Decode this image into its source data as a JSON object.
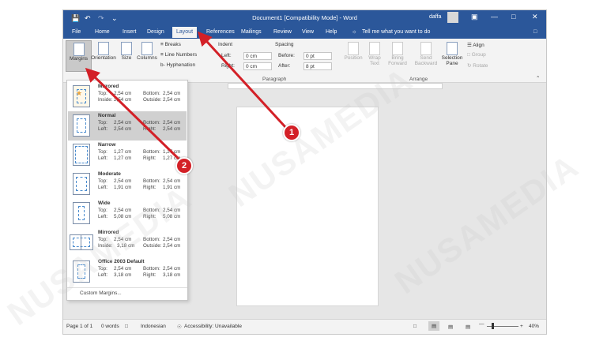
{
  "window": {
    "title": "Document1 [Compatibility Mode] - Word",
    "user": "daffa"
  },
  "tabs": [
    "File",
    "Home",
    "Insert",
    "Design",
    "Layout",
    "References",
    "Mailings",
    "Review",
    "View",
    "Help"
  ],
  "tell_me": "Tell me what you want to do",
  "ribbon": {
    "margins": "Margins",
    "orientation": "Orientation",
    "size": "Size",
    "columns": "Columns",
    "breaks": "Breaks",
    "line_numbers": "Line Numbers",
    "hyphenation": "Hyphenation",
    "indent": "Indent",
    "left_label": "Left:",
    "left_value": "0 cm",
    "right_label": "Right:",
    "right_value": "0 cm",
    "spacing": "Spacing",
    "before_label": "Before:",
    "before_value": "0 pt",
    "after_label": "After:",
    "after_value": "8 pt",
    "paragraph_group": "Paragraph",
    "position": "Position",
    "wrap_text": "Wrap Text",
    "bring_forward": "Bring Forward",
    "send_backward": "Send Backward",
    "selection_pane": "Selection Pane",
    "align": "Align",
    "group": "Group",
    "rotate": "Rotate",
    "arrange_group": "Arrange"
  },
  "margin_options": [
    {
      "name": "Mirrored",
      "l1": "Top:",
      "v1": "2,54 cm",
      "r1": "Bottom:",
      "w1": "2,54 cm",
      "l2": "Inside:",
      "v2": "2,54 cm",
      "r2": "Outside:",
      "w2": "2,54 cm"
    },
    {
      "name": "Normal",
      "l1": "Top:",
      "v1": "2,54 cm",
      "r1": "Bottom:",
      "w1": "2,54 cm",
      "l2": "Left:",
      "v2": "2,54 cm",
      "r2": "Right:",
      "w2": "2,54 cm"
    },
    {
      "name": "Narrow",
      "l1": "Top:",
      "v1": "1,27 cm",
      "r1": "Bottom:",
      "w1": "1,27 cm",
      "l2": "Left:",
      "v2": "1,27 cm",
      "r2": "Right:",
      "w2": "1,27 cm"
    },
    {
      "name": "Moderate",
      "l1": "Top:",
      "v1": "2,54 cm",
      "r1": "Bottom:",
      "w1": "2,54 cm",
      "l2": "Left:",
      "v2": "1,91 cm",
      "r2": "Right:",
      "w2": "1,91 cm"
    },
    {
      "name": "Wide",
      "l1": "Top:",
      "v1": "2,54 cm",
      "r1": "Bottom:",
      "w1": "2,54 cm",
      "l2": "Left:",
      "v2": "5,08 cm",
      "r2": "Right:",
      "w2": "5,08 cm"
    },
    {
      "name": "Mirrored",
      "l1": "Top:",
      "v1": "2,54 cm",
      "r1": "Bottom:",
      "w1": "2,54 cm",
      "l2": "Inside:",
      "v2": "3,18 cm",
      "r2": "Outside:",
      "w2": "2,54 cm"
    },
    {
      "name": "Office 2003 Default",
      "l1": "Top:",
      "v1": "2,54 cm",
      "r1": "Bottom:",
      "w1": "2,54 cm",
      "l2": "Left:",
      "v2": "3,18 cm",
      "r2": "Right:",
      "w2": "3,18 cm"
    }
  ],
  "custom_margins": "Custom Margins...",
  "status": {
    "page": "Page 1 of 1",
    "words": "0 words",
    "language": "Indonesian",
    "accessibility": "Accessibility: Unavailable",
    "zoom": "40%"
  },
  "markers": {
    "one": "1",
    "two": "2"
  },
  "watermark": "NUSAMEDIA",
  "colors": {
    "word_blue": "#2b579a",
    "arrow_red": "#d32027"
  }
}
